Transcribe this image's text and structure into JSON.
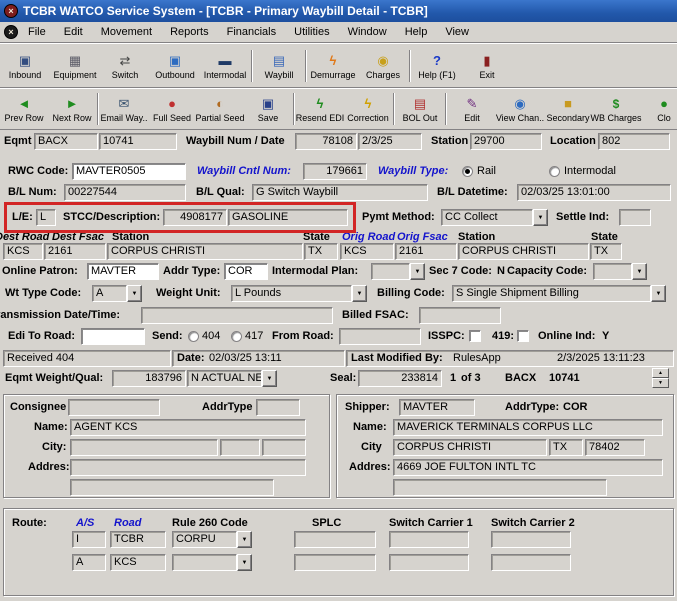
{
  "colors": {
    "titlebar_blue": "#2258ab",
    "label_blue": "#1414cc",
    "highlight_red": "#d22525",
    "window_gray": "#d6d3ce"
  },
  "window": {
    "title": "TCBR WATCO Service System - [TCBR - Primary Waybill Detail - TCBR]"
  },
  "menu": {
    "items": [
      "File",
      "Edit",
      "Movement",
      "Reports",
      "Financials",
      "Utilities",
      "Window",
      "Help",
      "View"
    ]
  },
  "toolbar_main": {
    "items": [
      {
        "label": "Inbound"
      },
      {
        "label": "Equipment"
      },
      {
        "label": "Switch"
      },
      {
        "label": "Outbound"
      },
      {
        "label": "Intermodal"
      },
      {
        "label": "Waybill"
      },
      {
        "label": "Demurrage"
      },
      {
        "label": "Charges"
      },
      {
        "label": "Help (F1)"
      },
      {
        "label": "Exit"
      }
    ]
  },
  "toolbar_actions": {
    "items": [
      {
        "label": "Prev Row"
      },
      {
        "label": "Next Row"
      },
      {
        "label": "Email Way.."
      },
      {
        "label": "Full Seed"
      },
      {
        "label": "Partial Seed"
      },
      {
        "label": "Save"
      },
      {
        "label": "Resend EDI"
      },
      {
        "label": "Correction"
      },
      {
        "label": "BOL Out"
      },
      {
        "label": "Edit"
      },
      {
        "label": "View Chan.."
      },
      {
        "label": "Secondary"
      },
      {
        "label": "WB Charges"
      },
      {
        "label": "Clo"
      }
    ]
  },
  "header": {
    "eqmt_label": "Eqmt",
    "eqmt_initial": "BACX",
    "eqmt_number": "10741",
    "waybill_num_date_label": "Waybill Num / Date",
    "waybill_num": "78108",
    "waybill_date": "2/3/25",
    "station_label": "Station",
    "station": "29700",
    "location_label": "Location",
    "location": "802"
  },
  "waybill": {
    "rwc_code_label": "RWC Code:",
    "rwc_code": "MAVTER0505",
    "cntl_num_label": "Waybill Cntl Num:",
    "cntl_num": "179661",
    "type_label": "Waybill Type:",
    "type_rail": "Rail",
    "type_intermodal": "Intermodal",
    "bl_num_label": "B/L Num:",
    "bl_num": "00227544",
    "bl_qual_label": "B/L Qual:",
    "bl_qual": "G Switch Waybill",
    "bl_datetime_label": "B/L Datetime:",
    "bl_datetime": "02/03/25 13:01:00",
    "le_label": "L/E:",
    "le": "L",
    "stcc_label": "STCC/Description:",
    "stcc_code": "4908177",
    "stcc_desc": "GASOLINE",
    "pymt_method_label": "Pymt Method:",
    "pymt_method": "CC Collect",
    "settle_ind_label": "Settle Ind:",
    "settle_ind": ""
  },
  "od": {
    "dest_road_label": "Dest Road",
    "dest_fsac_label": "Dest Fsac",
    "dest_station_label": "Station",
    "dest_state_label": "State",
    "orig_road_label": "Orig Road",
    "orig_fsac_label": "Orig Fsac",
    "orig_station_label": "Station",
    "orig_state_label": "State",
    "dest_road": "KCS",
    "dest_fsac": "2161",
    "dest_station": "CORPUS CHRISTI",
    "dest_state": "TX",
    "orig_road": "KCS",
    "orig_fsac": "2161",
    "orig_station": "CORPUS CHRISTI",
    "orig_state": "TX"
  },
  "details": {
    "online_patron_label": "Online Patron:",
    "online_patron": "MAVTER",
    "addr_type_label": "Addr Type:",
    "addr_type": "COR",
    "intermodal_plan_label": "Intermodal Plan:",
    "intermodal_plan": "",
    "sec7_label": "Sec 7 Code:",
    "sec7": "N",
    "capacity_label": "Capacity Code:",
    "capacity": "",
    "wt_type_label": "Wt Type Code:",
    "wt_type": "A",
    "weight_unit_label": "Weight Unit:",
    "weight_unit": "L Pounds",
    "billing_label": "Billing Code:",
    "billing": "S Single Shipment Billing",
    "transmission_label": "Transmission Date/Time:",
    "transmission": "",
    "billed_fsac_label": "Billed FSAC:",
    "billed_fsac": "",
    "edi_to_road_label": "Edi To Road:",
    "edi_to_road": "",
    "send_label": "Send:",
    "send_404": "404",
    "send_417": "417",
    "from_road_label": "From Road:",
    "from_road": "",
    "isspc_label": "ISSPC:",
    "r419_label": "419:",
    "online_ind_label": "Online Ind:",
    "online_ind": "Y"
  },
  "status": {
    "received": "Received 404",
    "date_label": "Date:",
    "date": "02/03/25 13:11",
    "modified_label": "Last Modified By:",
    "modified_by": "RulesApp",
    "modified_at": "2/3/2025 13:11:23"
  },
  "equipment": {
    "weight_label": "Eqmt Weight/Qual:",
    "weight": "183796",
    "weight_qual": "N ACTUAL NET",
    "seal_label": "Seal:",
    "seal": "233814",
    "seal_index": "1",
    "seal_count_label": "of 3",
    "eqmt_initial": "BACX",
    "eqmt_number": "10741"
  },
  "consignee": {
    "title": "Consignee",
    "code": "",
    "addr_type_label": "AddrType",
    "addr_type": "",
    "name_label": "Name:",
    "name": "AGENT KCS",
    "city_label": "City:",
    "city": "",
    "state": "",
    "zip": "",
    "address_label": "Addres:",
    "address1": "",
    "address2": ""
  },
  "shipper": {
    "title": "Shipper:",
    "code": "MAVTER",
    "addr_type_label": "AddrType:",
    "addr_type": "COR",
    "name_label": "Name:",
    "name": "MAVERICK TERMINALS CORPUS LLC",
    "city_label": "City",
    "city": "CORPUS CHRISTI",
    "state": "TX",
    "zip": "78402",
    "address_label": "Addres:",
    "address1": "4669 JOE FULTON INTL TC",
    "address2": ""
  },
  "route": {
    "title": "Route:",
    "as_label": "A/S",
    "road_label": "Road",
    "rule260_label": "Rule 260 Code",
    "splc_label": "SPLC",
    "sw1_label": "Switch Carrier 1",
    "sw2_label": "Switch Carrier 2",
    "rows": [
      {
        "as": "I",
        "road": "TCBR",
        "rule260": "CORPU",
        "splc": "",
        "sw1": "",
        "sw2": ""
      },
      {
        "as": "A",
        "road": "KCS",
        "rule260": "",
        "splc": "",
        "sw1": "",
        "sw2": ""
      }
    ]
  }
}
